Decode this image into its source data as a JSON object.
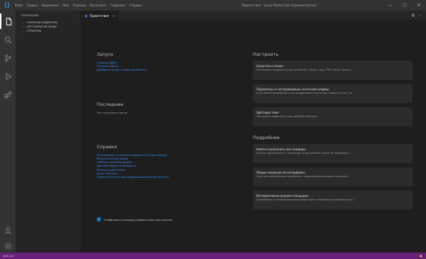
{
  "titlebar": {
    "menu": [
      "Файл",
      "Правка",
      "Выделение",
      "Вид",
      "Переход",
      "Выполнить",
      "Терминал",
      "Справка"
    ],
    "window_title": "Приветствие - Visual Studio Code [Администратор]",
    "controls": [
      "—",
      "▢",
      "✕"
    ]
  },
  "activitybar": {
    "items": [
      "files-icon",
      "search-icon",
      "source-control-icon",
      "run-debug-icon",
      "extensions-icon"
    ],
    "bottom": [
      "account-icon",
      "gear-icon"
    ]
  },
  "sidebar": {
    "title": "ПРОВОДНИК",
    "more": "···",
    "sections": [
      {
        "chevron": "›",
        "label": "ОТКРЫТЫЕ РЕДАКТОРЫ"
      },
      {
        "chevron": "›",
        "label": "НЕТ ОТКРЫТОЙ ПАПКИ"
      },
      {
        "chevron": "›",
        "label": "СТРУКТУРА"
      }
    ]
  },
  "tabs": [
    {
      "icon": "vscode-icon",
      "label": "Приветствие",
      "close": "×"
    }
  ],
  "tab_actions": [
    "▥",
    "···"
  ],
  "welcome": {
    "start": {
      "title": "Запуск",
      "links": [
        "Создать файл",
        "Открыть папку",
        "Добавить папку в рабочую область"
      ]
    },
    "recent": {
      "title": "Последние",
      "empty": "Нет последних папок."
    },
    "help": {
      "title": "Справка",
      "links": [
        "Печатаемые сочетания клавиш в Интерактивной",
        "Вступительные видео",
        "Советы и рекомендации",
        "Документация по продукту",
        "Репозиторий GitHub",
        "Stack Overflow",
        "Подписаться на наш информационный бюллетень"
      ]
    },
    "customize": {
      "title": "Настроить",
      "cards": [
        {
          "title": "Средства и языки",
          "desc": "Установите поддержку для JavaScript, Python, Java, PHP, Azure, Docker..."
        },
        {
          "title": "Параметры и настраиваемые сочетания клавиш",
          "desc": "Установите параметры и настраиваемые сочетания клавиш из Vim, Su..."
        },
        {
          "title": "Цветовая тема",
          "desc": "Настройте редактор и код удобным образом"
        }
      ]
    },
    "learn": {
      "title": "Подробнее",
      "cards": [
        {
          "title": "Найти и выполнить все команды",
          "desc": "Быстро обращайтесь к командам и выполняйте поиск по командам с..."
        },
        {
          "title": "Общие сведения об интерфейсе",
          "desc": "Получите визуальное наложение с выделением основных компоне..."
        },
        {
          "title": "Интерактивная игровая площадка",
          "desc": "Попробуйте основные функции редактора в коротком пошаговом руко..."
        }
      ]
    },
    "startup": {
      "check": "✓",
      "label": "Отображать страницу приветствия при запуске"
    }
  },
  "statusbar": {
    "left": "⊗ 0 ⚠ 0",
    "right": "🔔"
  },
  "colors": {
    "accent": "#3794ff",
    "statusbar": "#68217a",
    "background": "#1e1e1e"
  }
}
